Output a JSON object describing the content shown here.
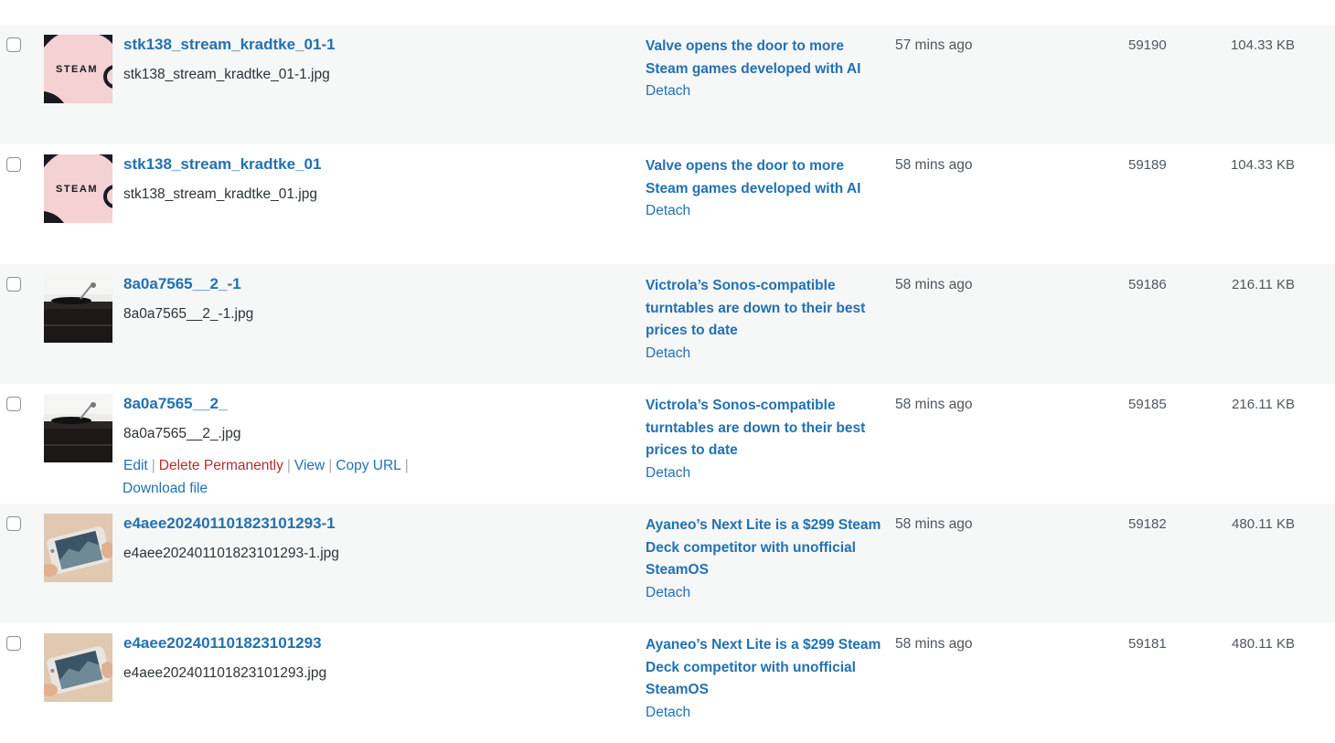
{
  "rows": [
    {
      "title": "stk138_stream_kradtke_01-1",
      "filename": "stk138_stream_kradtke_01-1.jpg",
      "thumb": "steam-logo",
      "attached_to": "Valve opens the door to more Steam games developed with AI",
      "detach": "Detach",
      "date": "57 mins ago",
      "id": "59190",
      "size": "104.33 KB"
    },
    {
      "title": "stk138_stream_kradtke_01",
      "filename": "stk138_stream_kradtke_01.jpg",
      "thumb": "steam-logo",
      "attached_to": "Valve opens the door to more Steam games developed with AI",
      "detach": "Detach",
      "date": "58 mins ago",
      "id": "59189",
      "size": "104.33 KB"
    },
    {
      "title": "8a0a7565__2_-1",
      "filename": "8a0a7565__2_-1.jpg",
      "thumb": "turntable",
      "attached_to": "Victrola’s Sonos-compatible turntables are down to their best prices to date",
      "detach": "Detach",
      "date": "58 mins ago",
      "id": "59186",
      "size": "216.11 KB"
    },
    {
      "title": "8a0a7565__2_",
      "filename": "8a0a7565__2_.jpg",
      "thumb": "turntable",
      "attached_to": "Victrola’s Sonos-compatible turntables are down to their best prices to date",
      "detach": "Detach",
      "date": "58 mins ago",
      "id": "59185",
      "size": "216.11 KB"
    },
    {
      "title": "e4aee202401101823101293-1",
      "filename": "e4aee202401101823101293-1.jpg",
      "thumb": "handheld",
      "attached_to": "Ayaneo’s Next Lite is a $299 Steam Deck competitor with unofficial SteamOS",
      "detach": "Detach",
      "date": "58 mins ago",
      "id": "59182",
      "size": "480.11 KB"
    },
    {
      "title": "e4aee202401101823101293",
      "filename": "e4aee202401101823101293.jpg",
      "thumb": "handheld",
      "attached_to": "Ayaneo’s Next Lite is a $299 Steam Deck competitor with unofficial SteamOS",
      "detach": "Detach",
      "date": "58 mins ago",
      "id": "59181",
      "size": "480.11 KB"
    }
  ],
  "row_actions": {
    "edit": "Edit",
    "delete": "Delete Permanently",
    "view": "View",
    "copy_url": "Copy URL",
    "download": "Download file",
    "separator": "|"
  },
  "thumb_text": {
    "steam": "STEAM"
  },
  "colors": {
    "link": "#2271b1",
    "delete": "#b32d2e",
    "alt_row": "#f6f7f7"
  }
}
